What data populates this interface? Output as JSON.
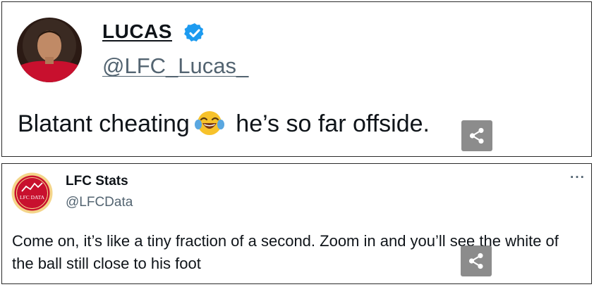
{
  "colors": {
    "verified": "#1d9bf0",
    "handle_gray": "#536471",
    "lfc_red": "#c8102e"
  },
  "tweet_quote": {
    "name": "LUCAS",
    "handle": "@LFC_Lucas_",
    "text_before": "Blatant cheating",
    "emoji": "joy-emoji",
    "text_after": "he’s so far offside."
  },
  "tweet_reply": {
    "name": "LFC Stats",
    "handle": "@LFCData",
    "avatar_text": "LFC DATA",
    "more_label": "···",
    "text": "Come on, it’s like a tiny fraction of a second. Zoom in and you’ll see the white of the ball still close to his foot"
  },
  "icons": [
    "verified-badge-icon",
    "share-icon",
    "more-icon",
    "trend-line-icon"
  ]
}
